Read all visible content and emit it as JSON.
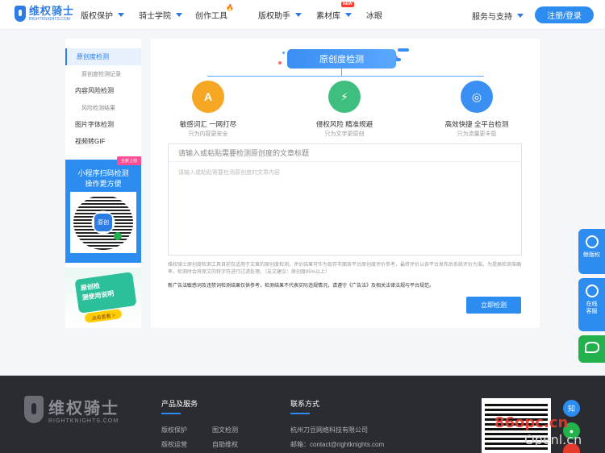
{
  "header": {
    "logo_cn": "维权骑士",
    "logo_en": "RIGHTKNIGHTS.COM",
    "nav": [
      {
        "label": "版权保护",
        "caret": true
      },
      {
        "label": "骑士学院",
        "caret": true
      },
      {
        "label": "创作工具",
        "caret": false,
        "hot": true
      },
      {
        "label": "版权助手",
        "caret": true
      },
      {
        "label": "素材库",
        "caret": true,
        "badge": "NEW"
      },
      {
        "label": "冰眼",
        "caret": false
      }
    ],
    "service_label": "服务与支持",
    "login_label": "注册/登录"
  },
  "sidebar": {
    "items": [
      {
        "label": "原创度检测",
        "level": "main",
        "active": true
      },
      {
        "label": "原创度检测记录",
        "level": "sub"
      },
      {
        "label": "内容风险检测",
        "level": "main"
      },
      {
        "label": "风险检测结果",
        "level": "sub"
      },
      {
        "label": "图片字体检测",
        "level": "main"
      },
      {
        "label": "视频转GIF",
        "level": "main"
      }
    ],
    "promo": {
      "badge": "全新上线",
      "line1": "小程序扫码检测",
      "line2": "操作更方便",
      "qr_logo": "原创"
    },
    "manual": {
      "line1": "原创检",
      "line2": "测使用说明",
      "button": "点击查看 >"
    }
  },
  "main": {
    "title": "原创度检测",
    "features": [
      {
        "title": "敏感词汇 一网打尽",
        "sub": "只为内容更安全",
        "icon": "document-icon",
        "color": "#f5a623",
        "glyph": "A"
      },
      {
        "title": "侵权风险 精准规避",
        "sub": "只为文字更原创",
        "icon": "shield-icon",
        "color": "#3fbf7f",
        "glyph": "⚡"
      },
      {
        "title": "高效快捷 全平台检测",
        "sub": "只为流量更丰盈",
        "icon": "target-icon",
        "color": "#3a8ff2",
        "glyph": "◎"
      }
    ],
    "title_placeholder": "请输入或粘贴需要检测原创度的文章标题",
    "body_placeholder": "请输入或粘贴需要检测原创度的文章内容",
    "note": "维权骑士原创度检测工具目前仅适用于文章的原创度检测，评价结果可作为现存市面各平台原创度评价参考，最终评价以各平台发布后系统评价为准。为提高检测准确率，检测时会将原文的特字符进行过滤处理。（友文建议：原创度85%以上）",
    "note2": "新广告法敏感词及违禁词检测结果仅供参考，检测结果不代表实际违规情况，请遵守《广告法》及相关法律法规与平台规范。",
    "check_button": "立即检测"
  },
  "float": {
    "item1": "鲸版权",
    "item2_line1": "在线",
    "item2_line2": "客服"
  },
  "footer": {
    "logo_cn": "维权骑士",
    "logo_en": "RIGHTKNIGHTS.COM",
    "col1_title": "产品及服务",
    "col1_links": [
      "版权保护",
      "图文检测",
      "版权运营",
      "自助维权"
    ],
    "col2_title": "联系方式",
    "company": "杭州刀豆网络科技有限公司",
    "email": "邮箱：contact@rightknights.com",
    "social": [
      "知"
    ]
  },
  "watermark": {
    "line1": "86opc.cn",
    "line2": "Openl.cn"
  }
}
